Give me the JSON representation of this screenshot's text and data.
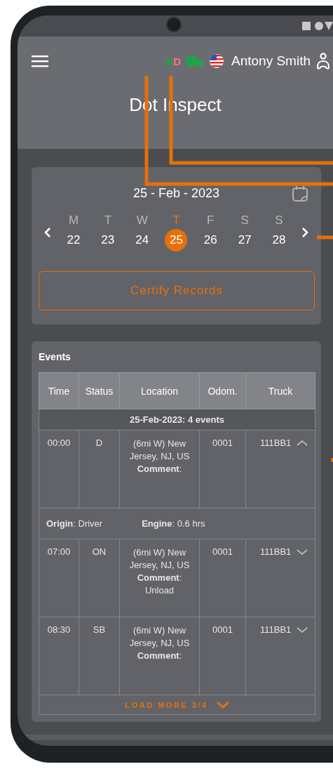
{
  "header": {
    "status_letters": [
      {
        "text": "M",
        "color": "#1fa34a"
      },
      {
        "text": "D",
        "color": "#ff6f8a"
      }
    ],
    "user_name": "Antony Smith",
    "title": "Dot Inspect"
  },
  "calendar": {
    "date": "25 - Feb - 2023",
    "days": [
      {
        "weekday": "M",
        "day": "22",
        "selected": false
      },
      {
        "weekday": "T",
        "day": "23",
        "selected": false
      },
      {
        "weekday": "W",
        "day": "24",
        "selected": false
      },
      {
        "weekday": "T",
        "day": "25",
        "selected": true
      },
      {
        "weekday": "F",
        "day": "26",
        "selected": false
      },
      {
        "weekday": "S",
        "day": "27",
        "selected": false
      },
      {
        "weekday": "S",
        "day": "28",
        "selected": false
      }
    ],
    "certify_button": "Certify Records"
  },
  "events": {
    "title": "Events",
    "columns": [
      "Time",
      "Status",
      "Location",
      "Odom.",
      "Truck"
    ],
    "group": "25-Feb-2023: 4 events",
    "rows": [
      {
        "time": "00:00",
        "status": "D",
        "location": "(6mi W) New Jersey, NJ, US",
        "comment": "**Comment**:",
        "odometer": "0001",
        "truck": "111BB1",
        "expanded": true,
        "details": [
          "**Origin**: Driver",
          "**Engine**: 0.6 hrs"
        ]
      },
      {
        "time": "07:00",
        "status": "ON",
        "location": "(6mi W) New Jersey, NJ, US",
        "comment": "**Comment**:",
        "note": "Unload",
        "odometer": "0001",
        "truck": "111BB1",
        "expanded": false
      },
      {
        "time": "08:30",
        "status": "SB",
        "location": "(6mi W) New Jersey, NJ, US",
        "comment": "**Comment**:",
        "odometer": "0001",
        "truck": "111BB1",
        "expanded": false
      }
    ],
    "load_more": "LOAD MORE 3/4"
  }
}
